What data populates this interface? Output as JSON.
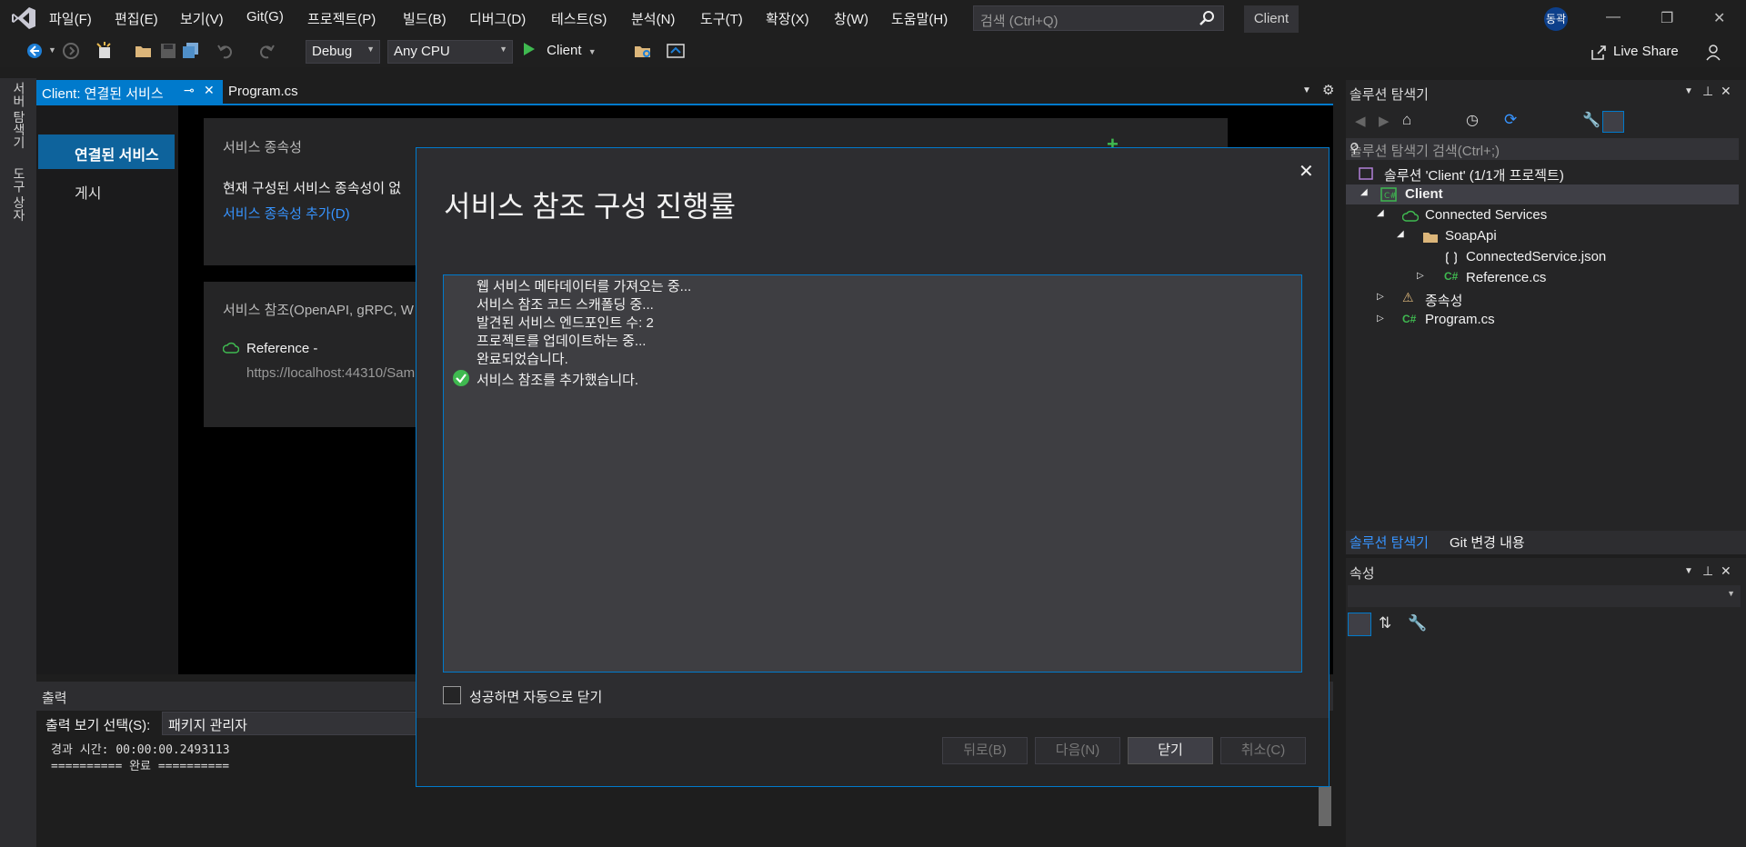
{
  "menu": {
    "items": [
      "파일(F)",
      "편집(E)",
      "보기(V)",
      "Git(G)",
      "프로젝트(P)",
      "빌드(B)",
      "디버그(D)",
      "테스트(S)",
      "분석(N)",
      "도구(T)",
      "확장(X)",
      "창(W)",
      "도움말(H)"
    ],
    "search_placeholder": "검색 (Ctrl+Q)",
    "solution_name": "Client",
    "user_initials": "동곽"
  },
  "toolbar": {
    "configuration": "Debug",
    "platform": "Any CPU",
    "run_target": "Client",
    "live_share": "Live Share"
  },
  "left_strip": {
    "server_explorer": "서버 탐색기",
    "toolbox": "도구 상자"
  },
  "doc_tabs": {
    "active": "Client: 연결된 서비스",
    "other": "Program.cs"
  },
  "connected_services": {
    "nav_selected": "연결된 서비스",
    "nav_publish": "게시",
    "deps_title": "서비스 종속성",
    "deps_text": "현재 구성된 서비스 종속성이 없",
    "deps_link": "서비스 종속성 추가(D)",
    "refs_title": "서비스 참조(OpenAPI, gRPC, W",
    "ref_name": "Reference -",
    "ref_url": "https://localhost:44310/Sam"
  },
  "output": {
    "title": "출력",
    "source_label": "출력 보기 선택(S):",
    "source_value": "패키지 관리자",
    "lines": [
      "경과 시간: 00:00:00.2493113",
      "========== 완료 =========="
    ]
  },
  "solution_explorer": {
    "title": "솔루션 탐색기",
    "search_placeholder": "솔루션 탐색기 검색(Ctrl+;)",
    "tree": {
      "solution": "솔루션 'Client' (1/1개 프로젝트)",
      "project": "Client",
      "connected_services": "Connected Services",
      "soapapi": "SoapApi",
      "json_file": "ConnectedService.json",
      "reference_file": "Reference.cs",
      "dependencies": "종속성",
      "program": "Program.cs"
    },
    "tab_active": "솔루션 탐색기",
    "tab_git": "Git 변경 내용"
  },
  "properties": {
    "title": "속성"
  },
  "dialog": {
    "title": "서비스 참조 구성 진행률",
    "log": [
      "웹 서비스 메타데이터를 가져오는 중...",
      "서비스 참조 코드 스캐폴딩 중...",
      "발견된 서비스 엔드포인트 수: 2",
      "프로젝트를 업데이트하는 중...",
      "완료되었습니다.",
      "서비스 참조를 추가했습니다."
    ],
    "auto_close_label": "성공하면 자동으로 닫기",
    "buttons": {
      "back": "뒤로(B)",
      "next": "다음(N)",
      "close": "닫기",
      "cancel": "취소(C)"
    },
    "success_color": "#3fb950",
    "accent_color": "#007acc"
  }
}
